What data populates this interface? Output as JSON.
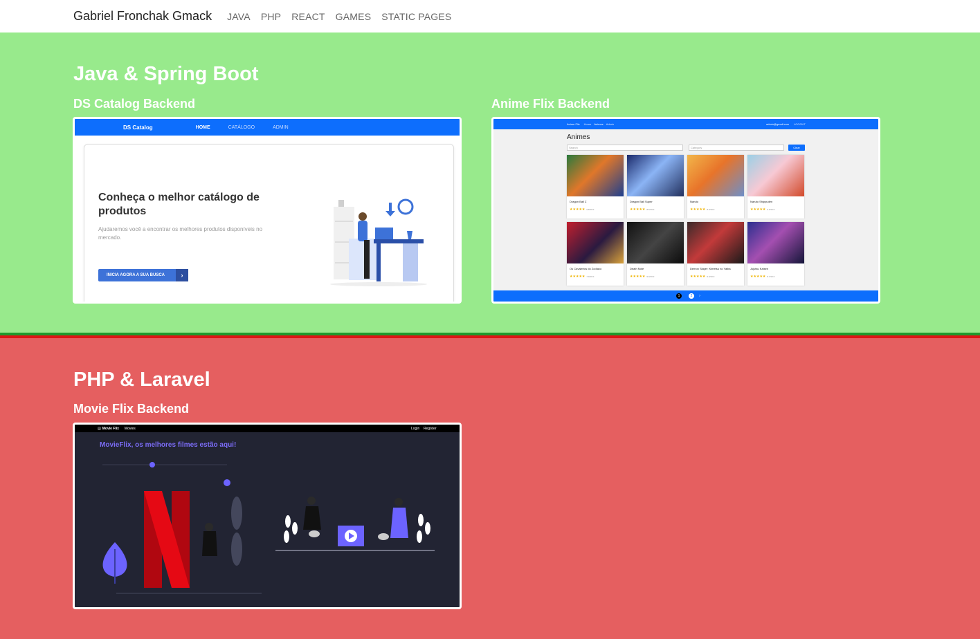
{
  "navbar": {
    "brand": "Gabriel Fronchak Gmack",
    "links": [
      "JAVA",
      "PHP",
      "REACT",
      "GAMES",
      "STATIC PAGES"
    ]
  },
  "sections": {
    "java": {
      "title": "Java & Spring Boot",
      "projects": [
        {
          "title": "DS Catalog Backend",
          "preview": {
            "brand": "DS Catalog",
            "nav": [
              "HOME",
              "CATÁLOGO",
              "ADMIN"
            ],
            "heading": "Conheça o melhor catálogo de produtos",
            "text": "Ajudaremos você a encontrar os melhores produtos disponíveis no mercado.",
            "button": "INICIA AGORA A SUA BUSCA"
          }
        },
        {
          "title": "Anime Flix Backend",
          "preview": {
            "brand": "Anime Flix",
            "nav": [
              "Home",
              "Animes",
              "Admin"
            ],
            "user": "admin@gmail.com",
            "logout": "LOGOUT",
            "heading": "Animes",
            "search_placeholder": "Search",
            "category_placeholder": "Category",
            "clear": "Clear",
            "animes": [
              {
                "name": "Dragon Ball Z",
                "rating": "9.8/10.0"
              },
              {
                "name": "Dragon Ball Super",
                "rating": "8.5/10.0"
              },
              {
                "name": "Naruto",
                "rating": "8.5/10.0"
              },
              {
                "name": "Naruto Shippuden",
                "rating": "9.0/10.0"
              },
              {
                "name": "Os Cavaleiros do Zodíaco",
                "rating": "7.0/10.0"
              },
              {
                "name": "Death Note",
                "rating": "9.0/10.0"
              },
              {
                "name": "Demon Slayer: Kimetsu no Yaiba",
                "rating": "9.0/10.0"
              },
              {
                "name": "Jujutsu Kaisen",
                "rating": "8.7/10.0"
              }
            ],
            "pages": [
              "1",
              "2"
            ]
          }
        }
      ]
    },
    "php": {
      "title": "PHP & Laravel",
      "projects": [
        {
          "title": "Movie Flix Backend",
          "preview": {
            "brand": "Movie Flix",
            "nav": [
              "Movies"
            ],
            "login": "Login",
            "register": "Register",
            "heading": "MovieFlix, os melhores filmes estão aqui!"
          }
        }
      ]
    }
  },
  "colors": {
    "java_bg": "#98ea8c",
    "php_bg": "#e55f60",
    "separator_green": "#1f9a2d",
    "separator_red": "#dd1616",
    "blue": "#0d6efd",
    "movieflix_accent": "#7b6cf6",
    "netflix_red": "#c4141c"
  }
}
